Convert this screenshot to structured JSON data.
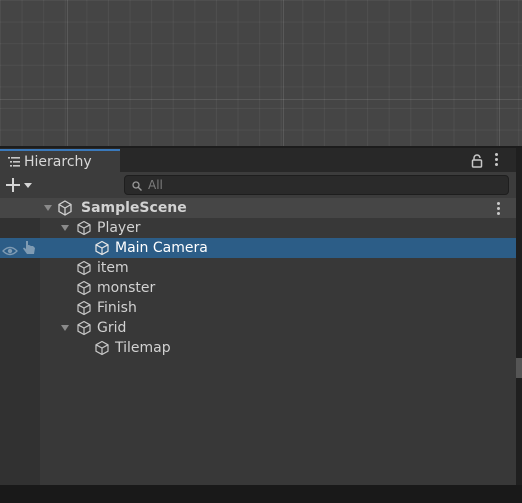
{
  "window": {
    "tab_label": "Hierarchy"
  },
  "toolbar": {
    "add_label": "+",
    "search_placeholder": "All"
  },
  "hierarchy": {
    "scene_name": "SampleScene",
    "items": [
      {
        "label": "Player",
        "depth": 1,
        "expanded": true
      },
      {
        "label": "Main Camera",
        "depth": 2,
        "selected": true
      },
      {
        "label": "item",
        "depth": 1
      },
      {
        "label": "monster",
        "depth": 1
      },
      {
        "label": "Finish",
        "depth": 1
      },
      {
        "label": "Grid",
        "depth": 1,
        "expanded": true
      },
      {
        "label": "Tilemap",
        "depth": 2
      }
    ]
  },
  "colors": {
    "selection": "#2c5d87",
    "tab_accent": "#3a79bb"
  },
  "icons": {
    "gameobject": "cube-icon",
    "scene": "unity-logo-icon",
    "visibility": "eye-icon",
    "pickability": "hand-pointer-icon"
  }
}
